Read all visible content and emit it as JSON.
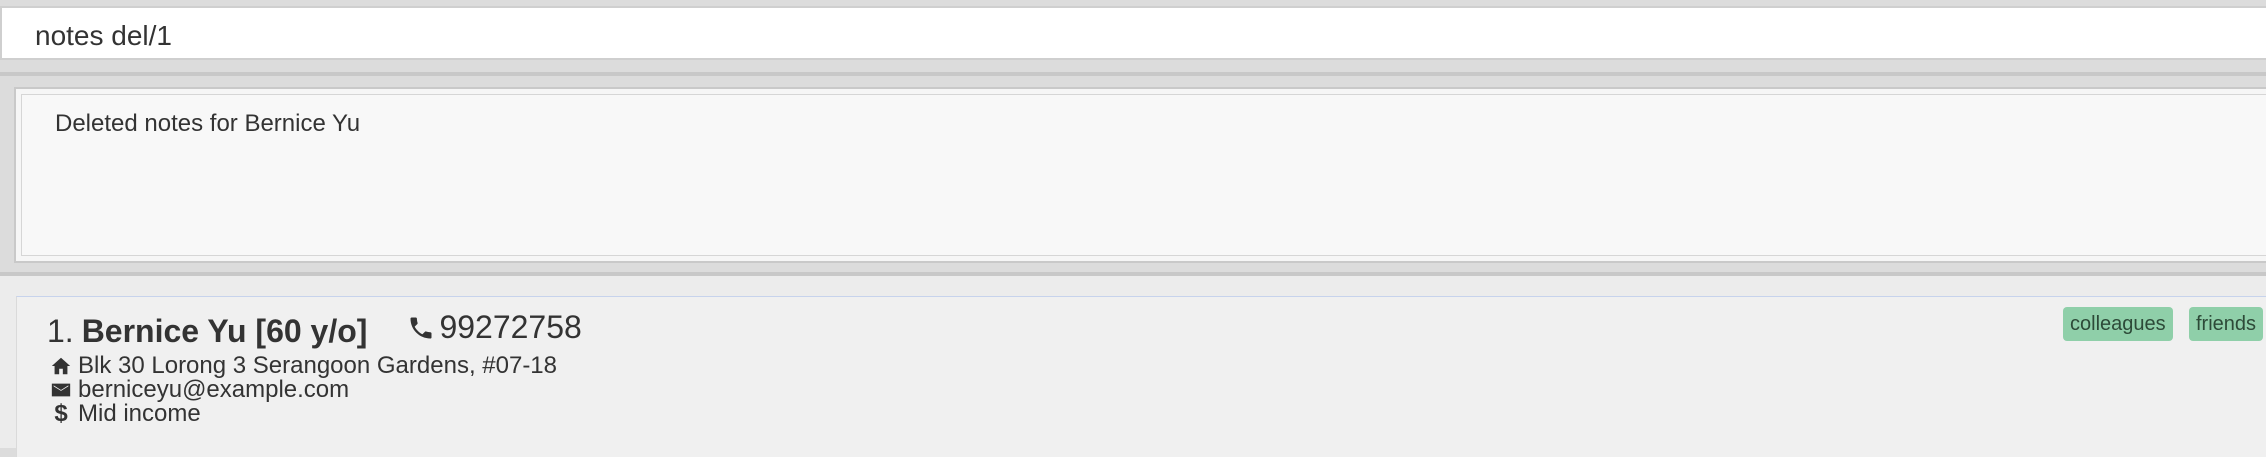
{
  "command_box": {
    "value": "notes del/1"
  },
  "result_display": {
    "message": "Deleted notes for Bernice Yu"
  },
  "person_list": {
    "cards": [
      {
        "index": "1.",
        "name": "Bernice Yu [60 y/o]",
        "phone": "99272758",
        "address": "Blk 30 Lorong 3 Serangoon Gardens, #07-18",
        "email": "berniceyu@example.com",
        "income": "Mid income",
        "tags": [
          "colleagues",
          "friends"
        ]
      }
    ]
  },
  "icons": {
    "phone": "phone-icon",
    "address": "home-icon",
    "email": "mail-icon",
    "income": "dollar-icon"
  },
  "colors": {
    "tag_bg": "#8fcfa9",
    "card_border_accent": "#c7d3ec"
  }
}
